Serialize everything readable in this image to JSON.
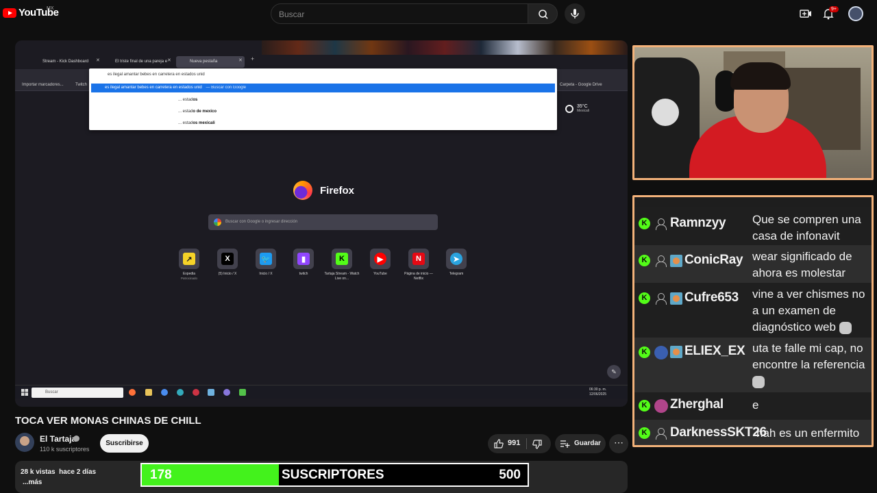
{
  "header": {
    "logo_text": "YouTube",
    "region": "MX",
    "search_placeholder": "Buscar",
    "notifications_badge": "9+"
  },
  "browser": {
    "tabs": [
      {
        "label": "Stream - Kick Dashboard"
      },
      {
        "label": "El triste final de una pareja ext"
      },
      {
        "label": "Nueva pestaña",
        "active": true
      }
    ],
    "bookmarks": [
      "Importar marcadores...",
      "Twitch",
      "Carpeta - Google Drive"
    ],
    "url_query": "es ilegal amantar bebes en carretera en estados unid",
    "suggestion_selected": "es ilegal amantar bebes en carretera en estados unid",
    "suggestion_selected_suffix": "— Buscar con Google",
    "suggestions": [
      {
        "prefix": "... estad",
        "bold": "os"
      },
      {
        "prefix": "... estad",
        "bold": "o de mexico"
      },
      {
        "prefix": "... estad",
        "bold": "os mexicali"
      }
    ],
    "weather": {
      "temp": "35°C",
      "city": "Mexicali"
    },
    "firefox_name": "Firefox",
    "firefox_search_placeholder": "Buscar con Google o ingresar dirección",
    "shortcuts": [
      {
        "label": "Expedia",
        "sub": "Patrocinado",
        "icon": "expedia-icon",
        "color": "#f5d328"
      },
      {
        "label": "(5) Inicio / X",
        "sub": "",
        "icon": "x-icon",
        "color": "#000000"
      },
      {
        "label": "Inicio / X",
        "sub": "",
        "icon": "twitter-icon",
        "color": "#1d9bf0"
      },
      {
        "label": "twitch",
        "sub": "",
        "icon": "twitch-icon",
        "color": "#9146ff"
      },
      {
        "label": "Tartaja Stream - Watch Live on...",
        "sub": "",
        "icon": "kick-icon",
        "color": "#53fc18"
      },
      {
        "label": "YouTube",
        "sub": "",
        "icon": "youtube-icon",
        "color": "#ff0000"
      },
      {
        "label": "Página de inicio — Netflix",
        "sub": "",
        "icon": "netflix-icon",
        "color": "#e50914"
      },
      {
        "label": "Telegram",
        "sub": "",
        "icon": "telegram-icon",
        "color": "#2aa3df"
      }
    ],
    "taskbar_search": "Buscar",
    "clock_time": "06:30 p. m.",
    "clock_date": "12/06/2025"
  },
  "chat": {
    "messages": [
      {
        "user": "Ramnzyy",
        "text": "Que se compren una casa de infonavit",
        "badge": "none"
      },
      {
        "user": "ConicRay",
        "text": "wear significado de ahora es molestar",
        "badge": "sub"
      },
      {
        "user": "Cufre653",
        "text": "vine a ver chismes no a un examen de diagnóstico web",
        "badge": "sub"
      },
      {
        "user": "ELIEX_EX",
        "text": "uta te falle mi cap, no encontre la referencia",
        "badge": "sub-avatar"
      },
      {
        "user": "Zherghal",
        "text": "e",
        "badge": "avatar"
      },
      {
        "user": "DarknessSKT26",
        "text": "nah es un enfermito",
        "badge": "none"
      }
    ]
  },
  "video": {
    "title": "TOCA VER MONAS CHINAS DE CHILL",
    "channel_name": "El Tartaja",
    "subscribers": "110 k suscriptores",
    "subscribe_label": "Suscribirse",
    "likes": "991",
    "save_label": "Guardar",
    "views_and_date": "28 k vistas  hace 2 días",
    "more_label": "...más"
  },
  "goal": {
    "current": "178",
    "label": "SUSCRIPTORES",
    "max": "500",
    "progress": 0.356,
    "fill_color": "#43f21c"
  }
}
